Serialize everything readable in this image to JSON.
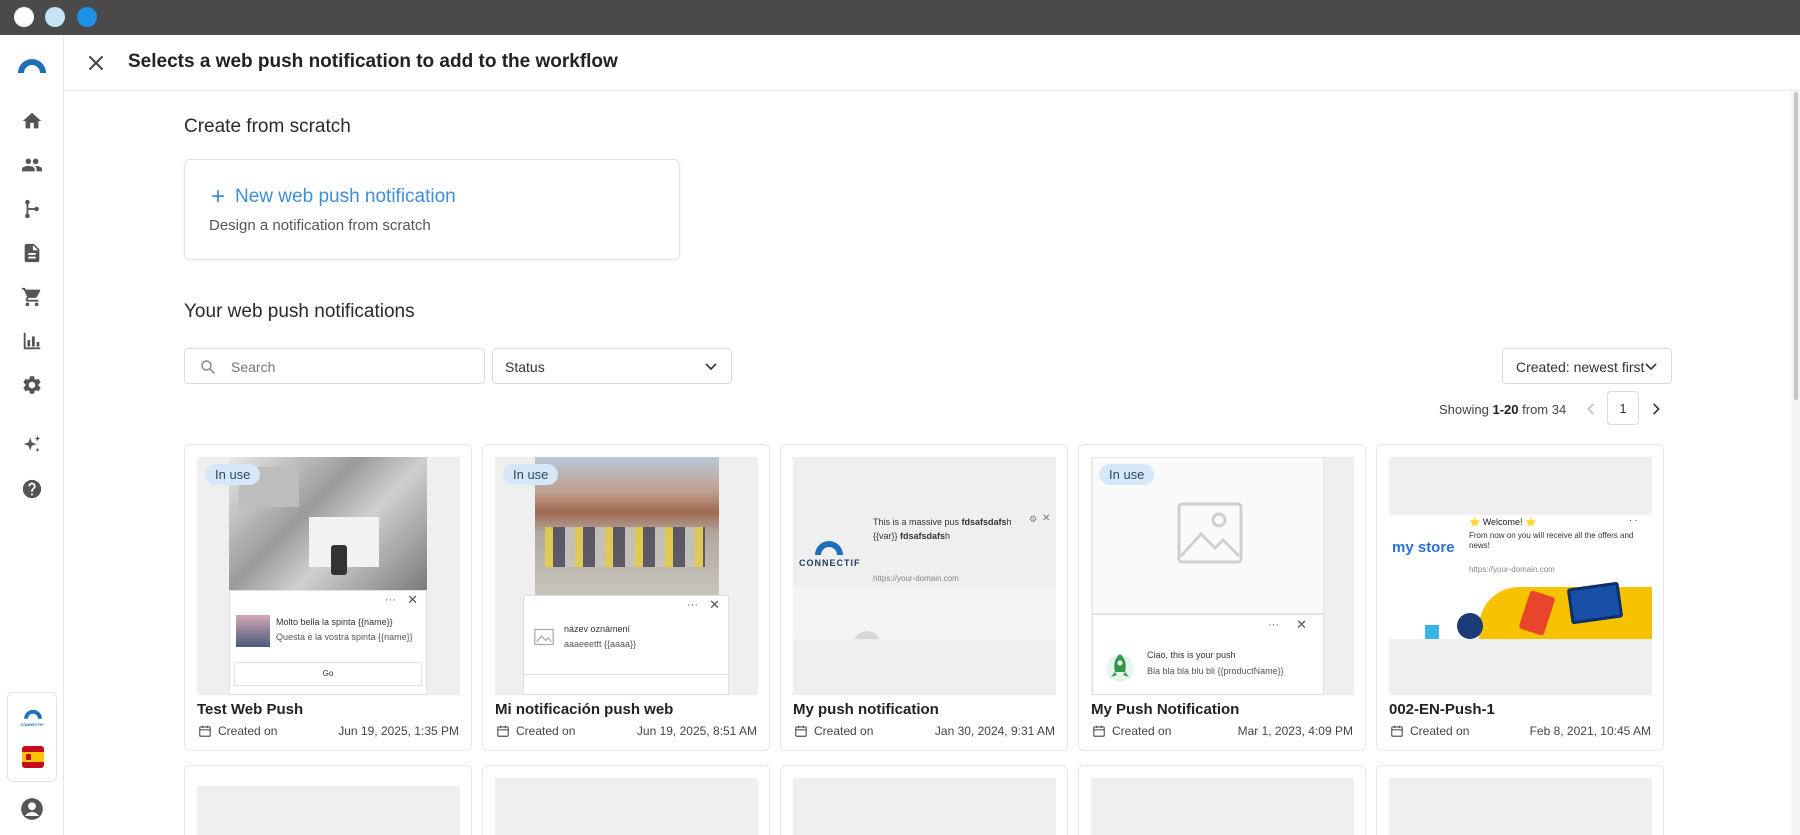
{
  "window": {
    "title": "Selects a web push notification to add to the workflow"
  },
  "sidebar": {
    "items": [
      {
        "name": "home-icon"
      },
      {
        "name": "contacts-icon"
      },
      {
        "name": "workflow-icon"
      },
      {
        "name": "content-icon"
      },
      {
        "name": "cart-icon"
      },
      {
        "name": "analytics-icon"
      },
      {
        "name": "settings-icon"
      },
      {
        "name": "ai-sparkle-icon"
      },
      {
        "name": "help-icon"
      }
    ],
    "brand_text": "CONNECTIF"
  },
  "create": {
    "heading": "Create from scratch",
    "new_label": "New web push notification",
    "new_desc": "Design a notification from scratch"
  },
  "list": {
    "heading": "Your web push notifications",
    "search_placeholder": "Search",
    "status_label": "Status",
    "sort_label": "Created: newest first",
    "paging": {
      "prefix": "Showing ",
      "range": "1-20",
      "suffix": " from 34",
      "page": "1"
    }
  },
  "cards": [
    {
      "title": "Test Web Push",
      "in_use": "In use",
      "created_label": "Created on",
      "date": "Jun 19, 2025, 1:35 PM",
      "preview": {
        "line1": "Molto bella la spinta {{name}}",
        "line2": "Questa è la vostra spinta {{name}}",
        "button": "Go"
      }
    },
    {
      "title": "Mi notificación push web",
      "in_use": "In use",
      "created_label": "Created on",
      "date": "Jun 19, 2025, 8:51 AM",
      "preview": {
        "line1": "název oznámení",
        "line2": "aaaeeettt {{aaaa}}"
      }
    },
    {
      "title": "My push notification",
      "created_label": "Created on",
      "date": "Jan 30, 2024, 9:31 AM",
      "preview": {
        "line1a": "This is a massive pus ",
        "line1b": "fdsafsdafs",
        "line1c": "h",
        "line2a": "{{var}} ",
        "line2b": "fdsafsdafs",
        "line2c": "h",
        "domain": "https://your-domain.com",
        "logo": "CONNECTIF"
      }
    },
    {
      "title": "My Push Notification",
      "in_use": "In use",
      "created_label": "Created on",
      "date": "Mar 1, 2023, 4:09 PM",
      "preview": {
        "line1": "Ciao, this is your push",
        "line2": "Bla bla bla blu bli {{productName}}"
      }
    },
    {
      "title": "002-EN-Push-1",
      "created_label": "Created on",
      "date": "Feb 8, 2021, 10:45 AM",
      "preview": {
        "store": "my store",
        "welcome": "⭐ Welcome! ⭐",
        "body": "From now on you will receive all the offers and news!",
        "domain": "https://your-domain.com"
      }
    }
  ],
  "colors": {
    "accent": "#3d8fd8",
    "badge_bg": "#d6e7f8",
    "titlebar": "#4a4a4a",
    "brand": "#1f6fb8"
  }
}
